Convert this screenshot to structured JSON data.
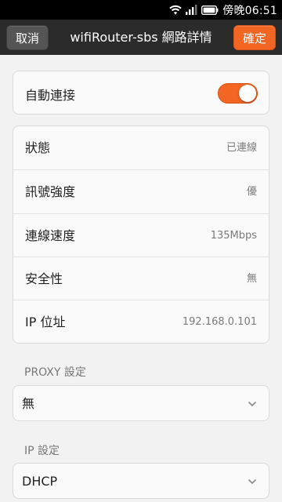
{
  "status_bar": {
    "time": "傍晚06:51",
    "icons": [
      "wifi-icon",
      "signal-icon",
      "battery-icon"
    ]
  },
  "header": {
    "cancel_label": "取消",
    "title": "wifiRouter-sbs 網路詳情",
    "confirm_label": "確定"
  },
  "auto_connect": {
    "label": "自動連接",
    "enabled": true
  },
  "info": {
    "rows": [
      {
        "label": "狀態",
        "value": "已連線"
      },
      {
        "label": "訊號強度",
        "value": "優"
      },
      {
        "label": "連線速度",
        "value": "135Mbps"
      },
      {
        "label": "安全性",
        "value": "無"
      },
      {
        "label": "IP 位址",
        "value": "192.168.0.101"
      }
    ]
  },
  "proxy": {
    "section_label": "PROXY 設定",
    "selected": "無"
  },
  "ip_settings": {
    "section_label": "IP 設定",
    "selected": "DHCP"
  },
  "colors": {
    "accent": "#f26522",
    "title_bar": "#2b2b2b",
    "background": "#f2f2f2"
  }
}
